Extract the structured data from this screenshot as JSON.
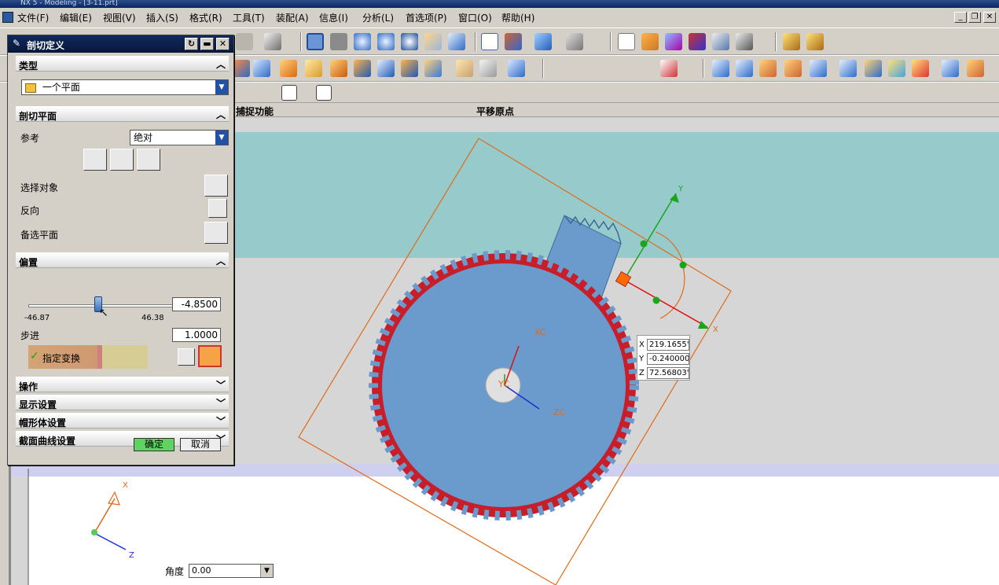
{
  "window": {
    "title": "NX 5 - Modeling - [3-11.prt]",
    "minimize": "_",
    "restore": "❐",
    "close": "✕"
  },
  "menu": [
    "文件(F)",
    "编辑(E)",
    "视图(V)",
    "插入(S)",
    "格式(R)",
    "工具(T)",
    "装配(A)",
    "信息(I)",
    "分析(L)",
    "首选项(P)",
    "窗口(O)",
    "帮助(H)"
  ],
  "selection_bar": {
    "capture_label": "捕捉功能",
    "move_origin_label": "平移原点"
  },
  "dialog": {
    "title": "剖切定义",
    "sections": {
      "type": "类型",
      "clip_plane": "剖切平面",
      "offset": "偏置",
      "operation": "操作",
      "display_settings": "显示设置",
      "cap_settings": "帽形体设置",
      "section_curve_settings": "截面曲线设置"
    },
    "type_value": "一个平面",
    "reference_label": "参考",
    "reference_value": "绝对",
    "select_object_label": "选择对象",
    "reverse_label": "反向",
    "alternate_plane_label": "备选平面",
    "offset_value": "-4.8500",
    "slider_min": "-46.87",
    "slider_max": "46.38",
    "slider_level": 0.475,
    "step_label": "步进",
    "step_value": "1.0000",
    "specify_transform_label": "指定变换",
    "ok_label": "确定",
    "cancel_label": "取消"
  },
  "viewport": {
    "coords": {
      "x_label": "X",
      "y_label": "Y",
      "z_label": "Z",
      "x_value": "219.1655'",
      "y_value": "-0.240000",
      "z_value": "72.56803'"
    },
    "angle_label": "角度",
    "angle_value": "0.00",
    "axis_labels": {
      "x": "X",
      "y": "Y",
      "xc": "XC",
      "yc": "YC",
      "zc": "ZC",
      "triad_x": "X",
      "triad_z": "Z"
    }
  },
  "colors": {
    "part_fill": "#6a9bcc",
    "teeth_red": "#c81e2a",
    "plane_orange": "#e06a1a",
    "sky_teal": "#97cbcb",
    "handle_green": "#1aa51a"
  }
}
